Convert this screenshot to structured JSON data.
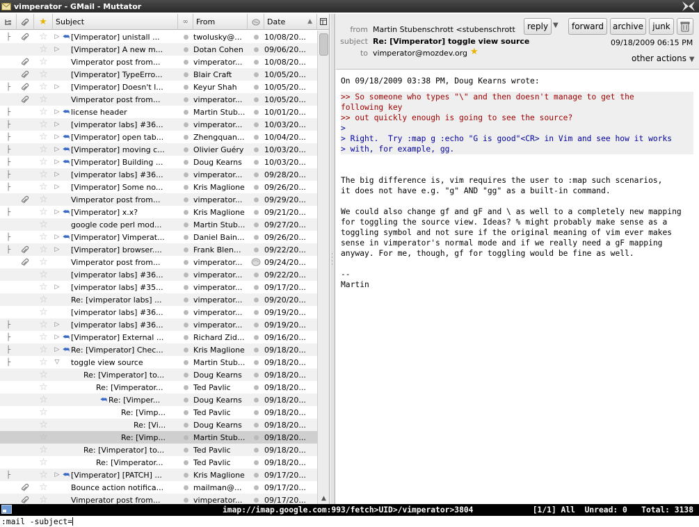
{
  "window": {
    "title": "vimperator - GMail - Muttator"
  },
  "thread_pane": {
    "columns": {
      "subject": "Subject",
      "from": "From",
      "date": "Date"
    },
    "rows": [
      {
        "indent": 0,
        "thread": "├",
        "attach": true,
        "twisty": "▷",
        "replied": true,
        "subject": "[Vimperator] unistall ...",
        "from": "twolusky@...",
        "date": "10/08/20...",
        "selected": false
      },
      {
        "indent": 0,
        "thread": "",
        "attach": false,
        "twisty": "▷",
        "replied": false,
        "subject": "[Vimperator] A new m...",
        "from": "Dotan Cohen",
        "date": "09/06/20...",
        "selected": false
      },
      {
        "indent": 0,
        "thread": "",
        "attach": true,
        "twisty": "",
        "replied": false,
        "subject": "Vimperator post from...",
        "from": "vimperator...",
        "date": "10/08/20...",
        "selected": false
      },
      {
        "indent": 0,
        "thread": "",
        "attach": true,
        "twisty": "",
        "replied": false,
        "subject": "[Vimperator] TypeErro...",
        "from": "Blair Craft",
        "date": "10/05/20...",
        "selected": false
      },
      {
        "indent": 0,
        "thread": "├",
        "attach": true,
        "twisty": "▷",
        "replied": false,
        "subject": "[Vimperator] Doesn't l...",
        "from": "Keyur Shah",
        "date": "10/05/20...",
        "selected": false
      },
      {
        "indent": 0,
        "thread": "",
        "attach": true,
        "twisty": "",
        "replied": false,
        "subject": "Vimperator post from...",
        "from": "vimperator...",
        "date": "10/05/20...",
        "selected": false
      },
      {
        "indent": 0,
        "thread": "├",
        "attach": false,
        "twisty": "▷",
        "replied": true,
        "subject": "license header",
        "from": "Martin Stub...",
        "date": "10/01/20...",
        "selected": false
      },
      {
        "indent": 0,
        "thread": "├",
        "attach": false,
        "twisty": "▷",
        "replied": false,
        "subject": "[vimperator labs] #36...",
        "from": "vimperator...",
        "date": "10/03/20...",
        "selected": false
      },
      {
        "indent": 0,
        "thread": "├",
        "attach": false,
        "twisty": "▷",
        "replied": true,
        "subject": "[Vimperator] open tab...",
        "from": "Zhengquan...",
        "date": "10/04/20...",
        "selected": false
      },
      {
        "indent": 0,
        "thread": "├",
        "attach": false,
        "twisty": "▷",
        "replied": true,
        "subject": "[Vimperator] moving c...",
        "from": "Olivier Guéry",
        "date": "10/03/20...",
        "selected": false
      },
      {
        "indent": 0,
        "thread": "├",
        "attach": false,
        "twisty": "▷",
        "replied": true,
        "subject": "[Vimperator] Building ...",
        "from": "Doug Kearns",
        "date": "10/03/20...",
        "selected": false
      },
      {
        "indent": 0,
        "thread": "├",
        "attach": false,
        "twisty": "▷",
        "replied": false,
        "subject": "[vimperator labs] #36...",
        "from": "vimperator...",
        "date": "09/28/20...",
        "selected": false
      },
      {
        "indent": 0,
        "thread": "├",
        "attach": false,
        "twisty": "▷",
        "replied": false,
        "subject": "[Vimperator] Some no...",
        "from": "Kris Maglione",
        "date": "09/26/20...",
        "selected": false
      },
      {
        "indent": 0,
        "thread": "",
        "attach": true,
        "twisty": "",
        "replied": false,
        "subject": "Vimperator post from...",
        "from": "vimperator...",
        "date": "09/29/20...",
        "selected": false
      },
      {
        "indent": 0,
        "thread": "├",
        "attach": false,
        "twisty": "▷",
        "replied": true,
        "subject": "[Vimperator] x.x?",
        "from": "Kris Maglione",
        "date": "09/21/20...",
        "selected": false
      },
      {
        "indent": 0,
        "thread": "",
        "attach": false,
        "twisty": "",
        "replied": false,
        "subject": "google code perl mod...",
        "from": "Martin Stub...",
        "date": "09/27/20...",
        "selected": false
      },
      {
        "indent": 0,
        "thread": "├",
        "attach": false,
        "twisty": "▷",
        "replied": true,
        "subject": "[Vimperator] Vimperat...",
        "from": "Daniel Bain...",
        "date": "09/26/20...",
        "selected": false
      },
      {
        "indent": 0,
        "thread": "├",
        "attach": true,
        "twisty": "▷",
        "replied": false,
        "subject": "[Vimperator] browser....",
        "from": "Frank Blen...",
        "date": "09/22/20...",
        "selected": false
      },
      {
        "indent": 0,
        "thread": "",
        "attach": true,
        "twisty": "",
        "replied": false,
        "subject": "Vimperator post from...",
        "from": "vimperator...",
        "date": "09/24/20...",
        "selected": false,
        "junk": true
      },
      {
        "indent": 0,
        "thread": "",
        "attach": false,
        "twisty": "",
        "replied": false,
        "subject": "[vimperator labs] #36...",
        "from": "vimperator...",
        "date": "09/22/20...",
        "selected": false
      },
      {
        "indent": 0,
        "thread": "",
        "attach": false,
        "twisty": "▷",
        "replied": false,
        "subject": "[vimperator labs] #35...",
        "from": "vimperator...",
        "date": "09/17/20...",
        "selected": false
      },
      {
        "indent": 0,
        "thread": "",
        "attach": false,
        "twisty": "",
        "replied": false,
        "subject": "Re: [vimperator labs] ...",
        "from": "vimperator...",
        "date": "09/20/20...",
        "selected": false
      },
      {
        "indent": 0,
        "thread": "",
        "attach": false,
        "twisty": "",
        "replied": false,
        "subject": "[vimperator labs] #36...",
        "from": "vimperator...",
        "date": "09/19/20...",
        "selected": false
      },
      {
        "indent": 0,
        "thread": "├",
        "attach": false,
        "twisty": "▷",
        "replied": false,
        "subject": "[vimperator labs] #36...",
        "from": "vimperator...",
        "date": "09/19/20...",
        "selected": false
      },
      {
        "indent": 0,
        "thread": "├",
        "attach": false,
        "twisty": "▷",
        "replied": true,
        "subject": "[Vimperator] External ...",
        "from": "Richard Zid...",
        "date": "09/16/20...",
        "selected": false
      },
      {
        "indent": 0,
        "thread": "├",
        "attach": false,
        "twisty": "▷",
        "replied": true,
        "subject": "Re: [Vimperator] Chec...",
        "from": "Kris Maglione",
        "date": "09/18/20...",
        "selected": false
      },
      {
        "indent": 0,
        "thread": "├",
        "attach": false,
        "twisty": "▽",
        "replied": false,
        "subject": "toggle view source",
        "from": "Martin Stub...",
        "date": "09/18/20...",
        "selected": false
      },
      {
        "indent": 1,
        "thread": "",
        "attach": false,
        "twisty": "",
        "replied": false,
        "subject": "Re: [Vimperator] to...",
        "from": "Doug Kearns",
        "date": "09/18/20...",
        "selected": false
      },
      {
        "indent": 2,
        "thread": "",
        "attach": false,
        "twisty": "",
        "replied": false,
        "subject": "Re: [Vimperator...",
        "from": "Ted Pavlic",
        "date": "09/18/20...",
        "selected": false
      },
      {
        "indent": 3,
        "thread": "",
        "attach": false,
        "twisty": "",
        "replied": true,
        "subject": "Re: [Vimper...",
        "from": "Doug Kearns",
        "date": "09/18/20...",
        "selected": false
      },
      {
        "indent": 4,
        "thread": "",
        "attach": false,
        "twisty": "",
        "replied": false,
        "subject": "Re: [Vimp...",
        "from": "Ted Pavlic",
        "date": "09/18/20...",
        "selected": false
      },
      {
        "indent": 5,
        "thread": "",
        "attach": false,
        "twisty": "",
        "replied": false,
        "subject": "Re: [Vi...",
        "from": "Doug Kearns",
        "date": "09/18/20...",
        "selected": false
      },
      {
        "indent": 4,
        "thread": "",
        "attach": false,
        "twisty": "",
        "replied": false,
        "subject": "Re: [Vimp...",
        "from": "Martin Stub...",
        "date": "09/18/20...",
        "selected": true
      },
      {
        "indent": 1,
        "thread": "",
        "attach": false,
        "twisty": "",
        "replied": false,
        "subject": "Re: [Vimperator] to...",
        "from": "Ted Pavlic",
        "date": "09/18/20...",
        "selected": false
      },
      {
        "indent": 2,
        "thread": "",
        "attach": false,
        "twisty": "",
        "replied": false,
        "subject": "Re: [Vimperator...",
        "from": "Ted Pavlic",
        "date": "09/18/20...",
        "selected": false
      },
      {
        "indent": 0,
        "thread": "├",
        "attach": false,
        "twisty": "▷",
        "replied": true,
        "subject": "[Vimperator] [PATCH] ...",
        "from": "Kris Maglione",
        "date": "09/17/20...",
        "selected": false
      },
      {
        "indent": 0,
        "thread": "",
        "attach": true,
        "twisty": "",
        "replied": false,
        "subject": "Bounce action notifica...",
        "from": "mailman@...",
        "date": "09/17/20...",
        "selected": false
      },
      {
        "indent": 0,
        "thread": "",
        "attach": true,
        "twisty": "",
        "replied": false,
        "subject": "Vimperator post from...",
        "from": "vimperator...",
        "date": "09/17/20...",
        "selected": false
      }
    ]
  },
  "message": {
    "labels": {
      "from": "from",
      "subject": "subject",
      "to": "to"
    },
    "from": "Martin Stubenschrott <stubenschrott",
    "subject": "Re: [Vimperator] toggle view source",
    "to": "vimperator@mozdev.org",
    "date": "09/18/2009 06:15 PM",
    "buttons": {
      "reply": "reply",
      "forward": "forward",
      "archive": "archive",
      "junk": "junk"
    },
    "other_actions": "other actions",
    "body": {
      "intro": "On 09/18/2009 03:38 PM, Doug Kearns wrote:",
      "quote_level2": [
        ">> So someone who types \"\\\" and then doesn't manage to get the",
        "following key",
        ">> out quickly enough is going to see the source?"
      ],
      "quote_level1": [
        ">",
        "> Right.  Try :map g :echo \"G is good\"<CR> in Vim and see how it works",
        "> with, for example, gg."
      ],
      "paragraphs": [
        "The big difference is, vim requires the user to :map such scenarios,\nit does not have e.g. \"g\" AND \"gg\" as a built-in command.",
        "We could also change gf and gF and \\ as well to a completely new mapping\nfor toggling the source view. Ideas? % might probably make sense as a\ntoggling symbol and not sure if the original meaning of vim ever makes\nsense in vimperator's normal mode and if we really need a gF mapping\nanyway. For me, though, gf for toggling would be fine as well.",
        "--\nMartin"
      ]
    }
  },
  "statusbar": {
    "url": "imap://imap.google.com:993/fetch>UID>/vimperator>3804",
    "info": "[1/1] All  Unread: 0   Total: 3138"
  },
  "commandline": {
    "text": ":mail -subject="
  },
  "colors": {
    "quote_level2": "#a00000",
    "quote_level1": "#0000a0",
    "reply_icon": "#3a6bc4"
  }
}
